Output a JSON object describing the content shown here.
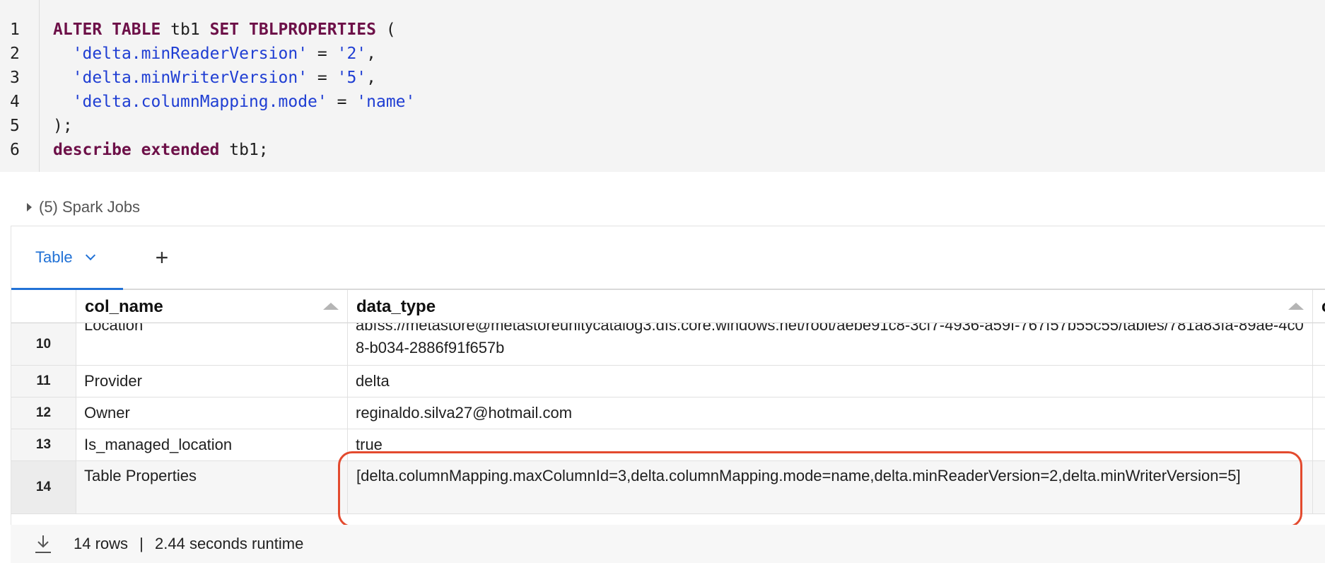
{
  "editor": {
    "line_numbers": [
      "1",
      "2",
      "3",
      "4",
      "5",
      "6"
    ],
    "lines": [
      [
        {
          "t": "ALTER TABLE",
          "k": "kw"
        },
        {
          "t": " tb1 ",
          "k": ""
        },
        {
          "t": "SET TBLPROPERTIES",
          "k": "kw"
        },
        {
          "t": " (",
          "k": ""
        }
      ],
      [
        {
          "t": "  ",
          "k": ""
        },
        {
          "t": "'delta.minReaderVersion'",
          "k": "str"
        },
        {
          "t": " = ",
          "k": ""
        },
        {
          "t": "'2'",
          "k": "str"
        },
        {
          "t": ",",
          "k": ""
        }
      ],
      [
        {
          "t": "  ",
          "k": ""
        },
        {
          "t": "'delta.minWriterVersion'",
          "k": "str"
        },
        {
          "t": " = ",
          "k": ""
        },
        {
          "t": "'5'",
          "k": "str"
        },
        {
          "t": ",",
          "k": ""
        }
      ],
      [
        {
          "t": "  ",
          "k": ""
        },
        {
          "t": "'delta.columnMapping.mode'",
          "k": "str"
        },
        {
          "t": " = ",
          "k": ""
        },
        {
          "t": "'name'",
          "k": "str"
        }
      ],
      [
        {
          "t": ");",
          "k": ""
        }
      ],
      [
        {
          "t": "describe extended",
          "k": "kw"
        },
        {
          "t": " tb1;",
          "k": ""
        }
      ]
    ]
  },
  "spark_jobs": {
    "label": "(5) Spark Jobs"
  },
  "result": {
    "tabs": [
      {
        "label": "Table"
      }
    ],
    "add_tab_label": "+",
    "columns": [
      "col_name",
      "data_type",
      "co"
    ],
    "rows": [
      {
        "index": "10",
        "col_name": "Location",
        "data_type": "abfss://metastore@metastoreunitycatalog3.dfs.core.windows.net/root/aebe91c8-3cf7-4936-a59f-767f57b55c55/tables/781a83fa-89ae-4c08-b034-2886f91f657b"
      },
      {
        "index": "11",
        "col_name": "Provider",
        "data_type": "delta"
      },
      {
        "index": "12",
        "col_name": "Owner",
        "data_type": "reginaldo.silva27@hotmail.com"
      },
      {
        "index": "13",
        "col_name": "Is_managed_location",
        "data_type": "true"
      },
      {
        "index": "14",
        "col_name": "Table Properties",
        "data_type": "[delta.columnMapping.maxColumnId=3,delta.columnMapping.mode=name,delta.minReaderVersion=2,delta.minWriterVersion=5]"
      }
    ]
  },
  "footer": {
    "rows_label": "14 rows",
    "separator": "|",
    "runtime_label": "2.44 seconds runtime"
  },
  "colors": {
    "accent": "#2272d6",
    "highlight": "#e34a2e",
    "keyword": "#6d1048",
    "string": "#1f3ed3"
  }
}
